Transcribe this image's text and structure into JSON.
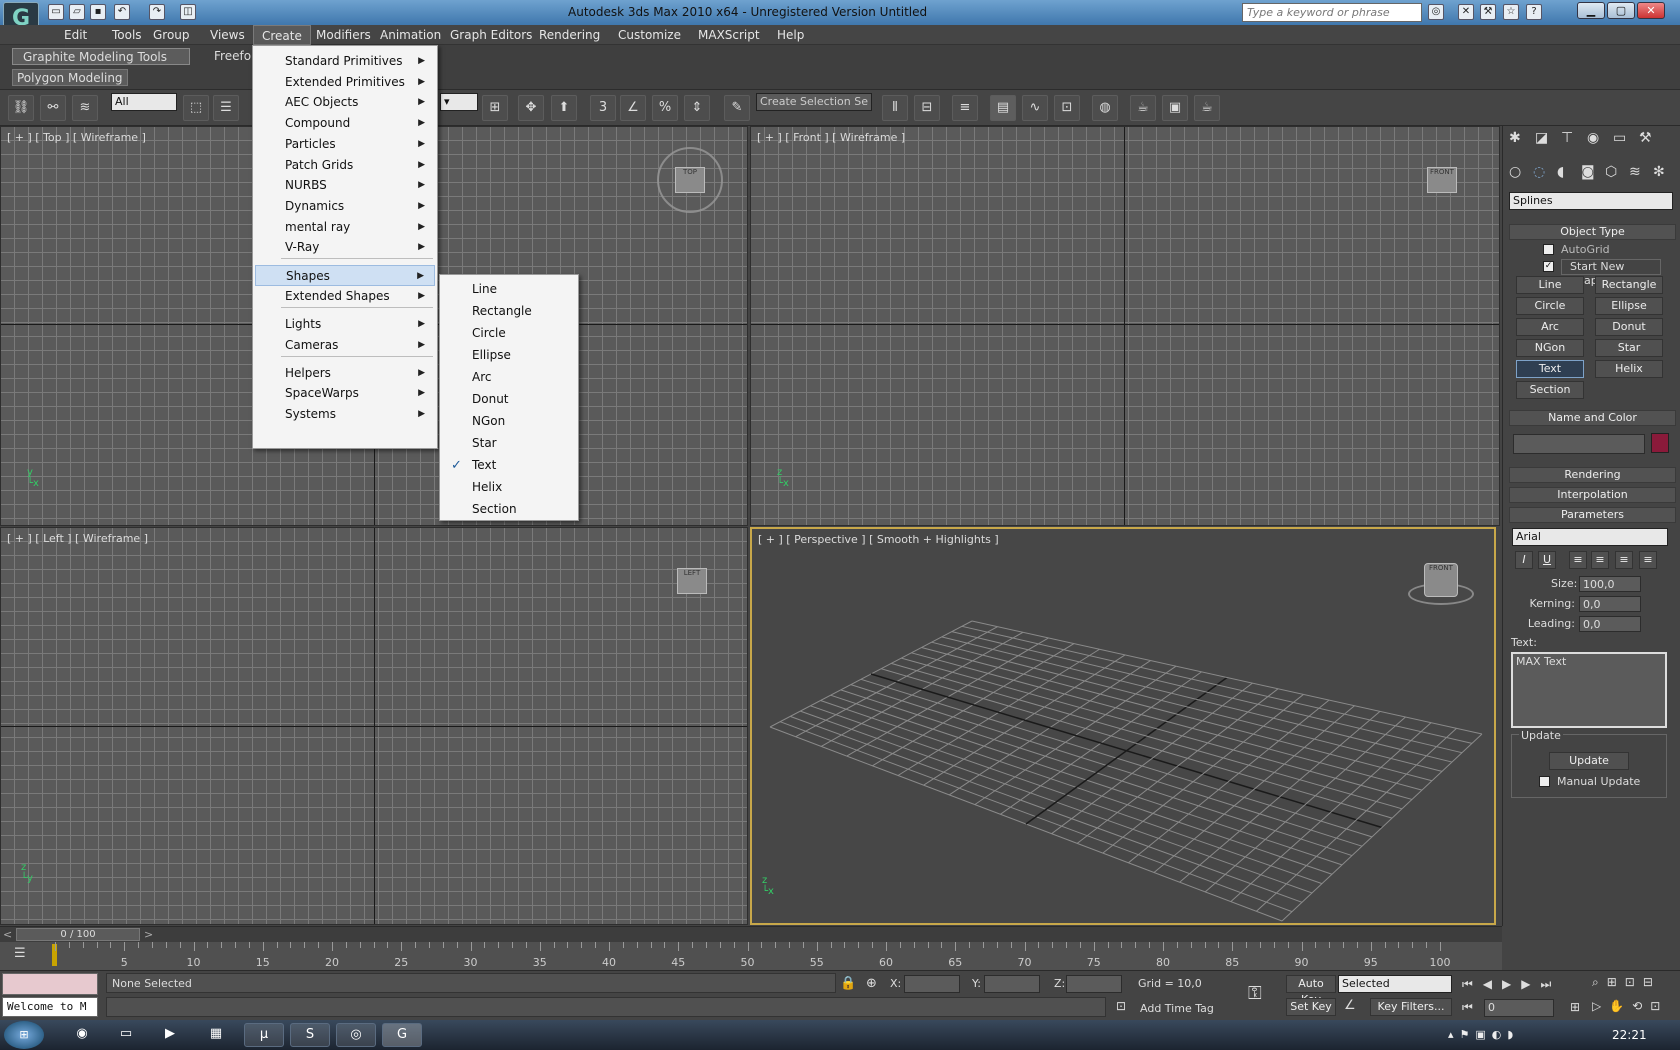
{
  "window": {
    "title": "Autodesk 3ds Max  2010 x64  - Unregistered Version     Untitled"
  },
  "search": {
    "placeholder": "Type a keyword or phrase"
  },
  "menubar": [
    "Edit",
    "Tools",
    "Group",
    "Views",
    "Create",
    "Modifiers",
    "Animation",
    "Graph Editors",
    "Rendering",
    "Customize",
    "MAXScript",
    "Help"
  ],
  "ribbon": {
    "tab1": "Graphite Modeling Tools",
    "tab2": "Freefor",
    "sub": "Polygon Modeling"
  },
  "toolbar": {
    "filter": "All",
    "selection_set": "Create Selection Se"
  },
  "viewports": {
    "top": "[ + ] [ Top ] [ Wireframe ]",
    "front": "[ + ] [ Front ] [ Wireframe ]",
    "left": "[ + ] [ Left ] [ Wireframe ]",
    "persp": "[ + ] [ Perspective ] [ Smooth + Highlights ]"
  },
  "create_menu": [
    "Standard Primitives",
    "Extended Primitives",
    "AEC Objects",
    "Compound",
    "Particles",
    "Patch Grids",
    "NURBS",
    "Dynamics",
    "mental ray",
    "V-Ray",
    "Shapes",
    "Extended Shapes",
    "Lights",
    "Cameras",
    "Helpers",
    "SpaceWarps",
    "Systems"
  ],
  "shapes_menu": [
    "Line",
    "Rectangle",
    "Circle",
    "Ellipse",
    "Arc",
    "Donut",
    "NGon",
    "Star",
    "Text",
    "Helix",
    "Section"
  ],
  "panel": {
    "category": "Splines",
    "object_type": "Object Type",
    "autogrid": "AutoGrid",
    "start_new_shape": "Start New Shape",
    "buttons": [
      "Line",
      "Rectangle",
      "Circle",
      "Ellipse",
      "Arc",
      "Donut",
      "NGon",
      "Star",
      "Text",
      "Helix",
      "Section"
    ],
    "name_color": "Name and Color",
    "rendering": "Rendering",
    "interpolation": "Interpolation",
    "parameters": "Parameters",
    "font": "Arial",
    "size_label": "Size:",
    "size_value": "100,0",
    "kerning_label": "Kerning:",
    "kerning_value": "0,0",
    "leading_label": "Leading:",
    "leading_value": "0,0",
    "text_label": "Text:",
    "text_value": "MAX Text",
    "update_group": "Update",
    "update_button": "Update",
    "manual_update": "Manual Update",
    "color_swatch": "#8a1a3a"
  },
  "timeline": {
    "frame": "0 / 100",
    "ticks": [
      "5",
      "10",
      "15",
      "20",
      "25",
      "30",
      "35",
      "40",
      "45",
      "50",
      "55",
      "60",
      "65",
      "70",
      "75",
      "80",
      "85",
      "90",
      "95",
      "100"
    ]
  },
  "status": {
    "selection": "None Selected",
    "welcome": "Welcome to M",
    "x": "X:",
    "y": "Y:",
    "z": "Z:",
    "grid": "Grid = 10,0",
    "auto_key": "Auto Key",
    "selected": "Selected",
    "set_key": "Set Key",
    "key_filters": "Key Filters...",
    "add_time_tag": "Add Time Tag",
    "frame_value": "0"
  },
  "taskbar": {
    "clock": "22:21"
  }
}
